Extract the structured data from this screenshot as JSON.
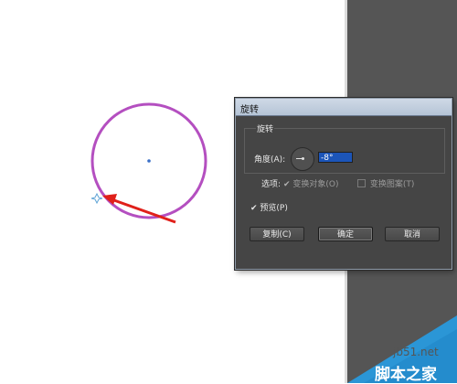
{
  "dialog": {
    "title": "旋转",
    "group_label": "旋转",
    "angle_label": "角度(A):",
    "angle_value": "-8°",
    "options_label": "选项:",
    "option_transform_objects": "变换对象(O)",
    "option_transform_patterns": "变换图案(T)",
    "preview_label": "预览(P)",
    "copy_button": "复制(C)",
    "ok_button": "确定",
    "cancel_button": "取消"
  },
  "watermark": {
    "domain": "jb51.net",
    "site_name": "脚本之家"
  },
  "colors": {
    "circle_stroke": "#b44fc0",
    "center_point": "#3a6fc7",
    "annotation_arrow": "#e0201a",
    "dialog_bg": "#454545",
    "dark_panel": "#555555",
    "watermark_triangle": "#2b96d6"
  }
}
